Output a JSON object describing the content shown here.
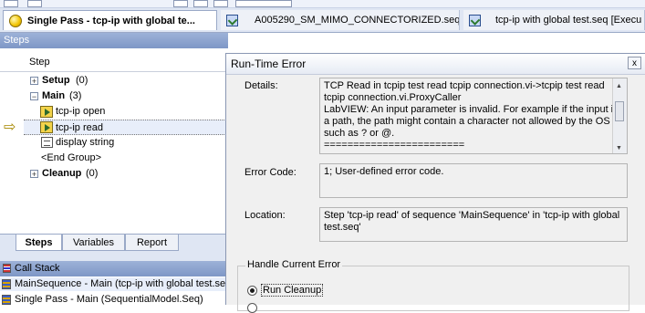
{
  "tabs": [
    {
      "label": "Single Pass - tcp-ip with global te...",
      "icon": "yellow-ball-icon"
    },
    {
      "label": "A005290_SM_MIMO_CONNECTORIZED.seq",
      "icon": "sequence-file-icon"
    },
    {
      "label": "tcp-ip with global test.seq [Execu",
      "icon": "sequence-file-icon"
    }
  ],
  "steps_panel": {
    "title": "Steps",
    "column_header": "Step",
    "rows": [
      {
        "toggle": "+",
        "label": "Setup",
        "count": "(0)"
      },
      {
        "toggle": "−",
        "label": "Main",
        "count": "(3)"
      },
      {
        "label": "tcp-ip open"
      },
      {
        "label": "tcp-ip read"
      },
      {
        "label": "display string"
      },
      {
        "label": "<End Group>"
      },
      {
        "toggle": "+",
        "label": "Cleanup",
        "count": "(0)"
      }
    ]
  },
  "bottom_tabs": [
    "Steps",
    "Variables",
    "Report"
  ],
  "call_stack": {
    "title": "Call Stack",
    "items": [
      "MainSequence - Main (tcp-ip with global test.seq)",
      "Single Pass - Main (SequentialModel.Seq)"
    ]
  },
  "dialog": {
    "title": "Run-Time Error",
    "close_glyph": "x",
    "details_label": "Details:",
    "details_lines": [
      "TCP Read in tcpip test read tcpip connection.vi->tcpip test read",
      "tcpip connection.vi.ProxyCaller",
      "LabVIEW:  An input parameter is invalid. For example if the input is",
      "a path, the path might contain a character not allowed by the OS",
      "such as ? or @.",
      "========================"
    ],
    "error_code_label": "Error Code:",
    "error_code_value": "1; User-defined error code.",
    "location_label": "Location:",
    "location_lines": [
      "Step 'tcp-ip read' of sequence 'MainSequence' in 'tcp-ip with global",
      "test.seq'"
    ],
    "handle_legend": "Handle Current Error",
    "option_run_cleanup": "Run Cleanup"
  }
}
